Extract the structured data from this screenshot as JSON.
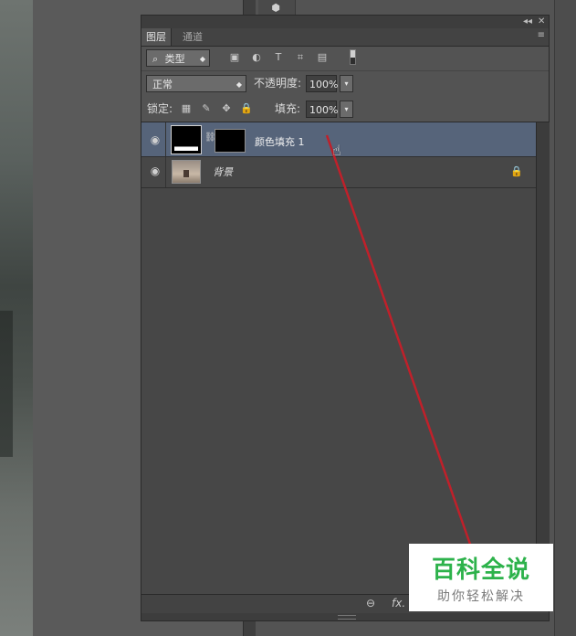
{
  "panel": {
    "tabs": [
      {
        "label": "图层",
        "active": true
      },
      {
        "label": "通道",
        "active": false
      }
    ],
    "title_buttons": {
      "collapse": "◂◂",
      "close": "✕"
    },
    "menu_icon": "≡"
  },
  "filter": {
    "kind_label": "类型",
    "search_icon": "⌕",
    "icons": [
      "image-filter-icon",
      "adjustment-filter-icon",
      "type-filter-icon",
      "shape-filter-icon",
      "smart-object-filter-icon"
    ]
  },
  "blend": {
    "mode": "正常",
    "opacity_label": "不透明度:",
    "opacity_value": "100%"
  },
  "lock": {
    "label": "锁定:",
    "fill_label": "填充:",
    "fill_value": "100%"
  },
  "layers": [
    {
      "name": "颜色填充 1",
      "selected": true,
      "type": "fill"
    },
    {
      "name": "背景",
      "selected": false,
      "type": "background",
      "locked": true
    }
  ],
  "bottom": {
    "link_icon": "⊖",
    "fx": "fx."
  },
  "watermark": {
    "title": "百科全说",
    "subtitle": "助你轻松解决"
  },
  "colors": {
    "selection": "#56647a",
    "annotation": "#c0202a",
    "watermark_green": "#2db24b"
  }
}
